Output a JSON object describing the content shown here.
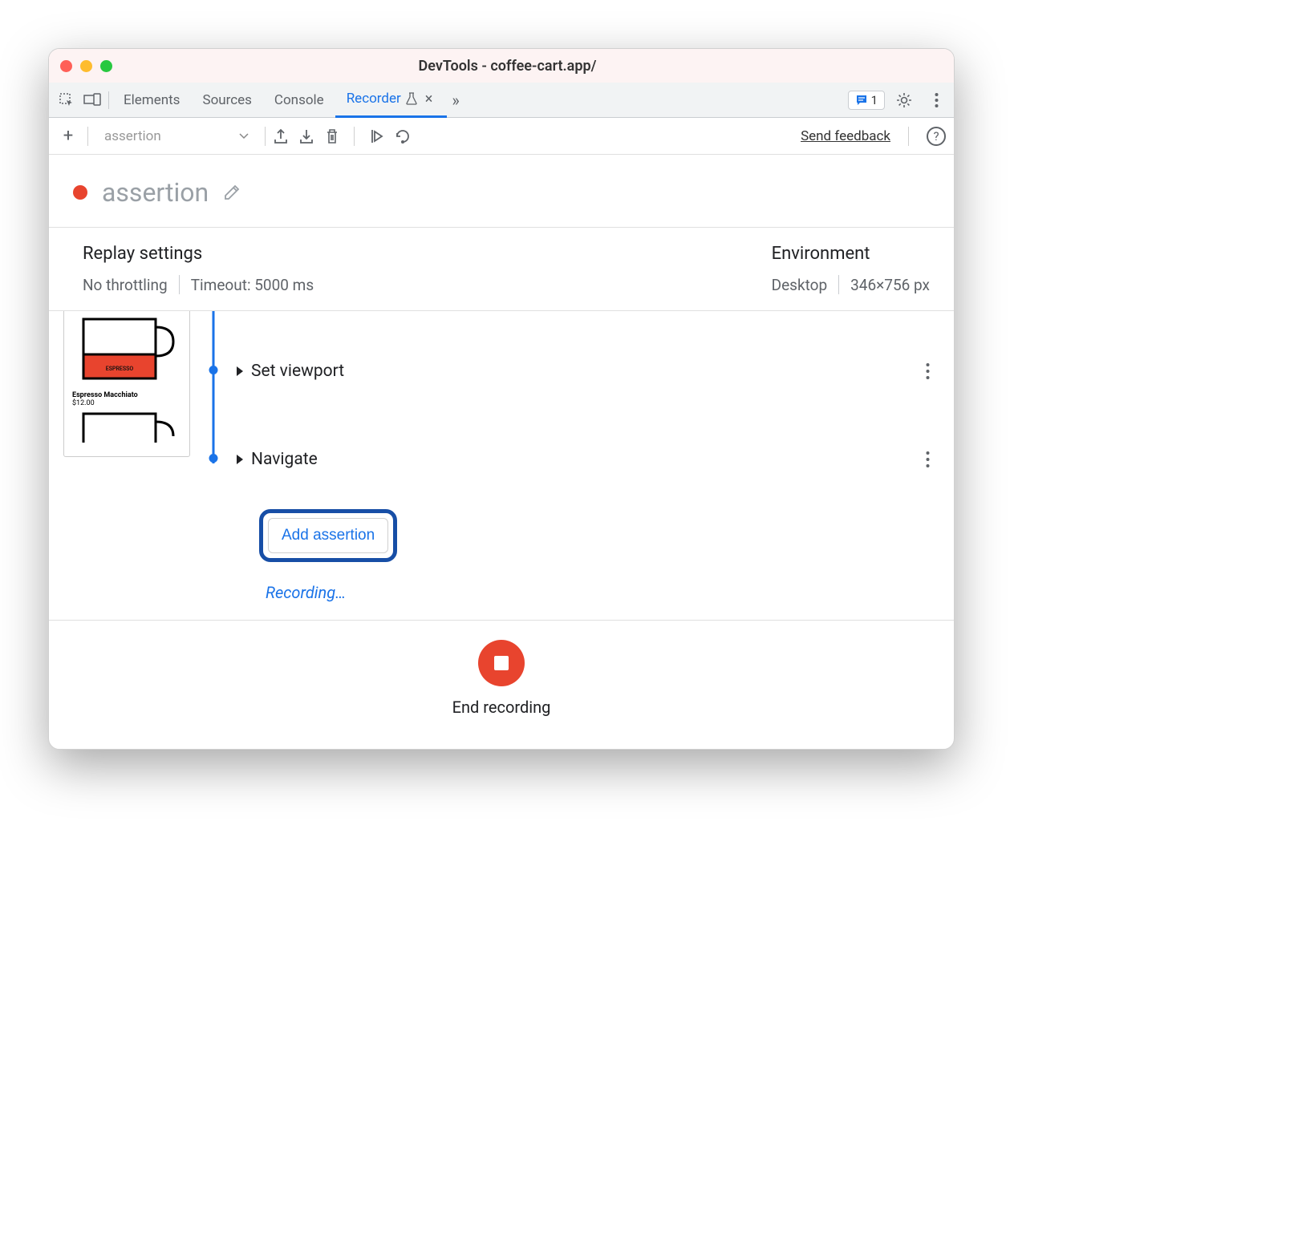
{
  "window": {
    "title": "DevTools - coffee-cart.app/"
  },
  "tabs": {
    "items": [
      "Elements",
      "Sources",
      "Console",
      "Recorder"
    ],
    "active": "Recorder"
  },
  "top_right": {
    "badge_count": "1"
  },
  "toolbar": {
    "recording_selector": "assertion",
    "send_feedback": "Send feedback",
    "help": "?"
  },
  "recording": {
    "title": "assertion"
  },
  "replay_settings": {
    "heading": "Replay settings",
    "throttling": "No throttling",
    "timeout": "Timeout: 5000 ms"
  },
  "environment": {
    "heading": "Environment",
    "device": "Desktop",
    "viewport": "346×756 px"
  },
  "thumbnail": {
    "product1_name": "Espresso Macchiato",
    "product1_price": "$12.00"
  },
  "steps": {
    "items": [
      {
        "label": "Set viewport"
      },
      {
        "label": "Navigate"
      }
    ],
    "add_assertion_label": "Add assertion",
    "recording_status": "Recording…"
  },
  "end": {
    "label": "End recording"
  }
}
